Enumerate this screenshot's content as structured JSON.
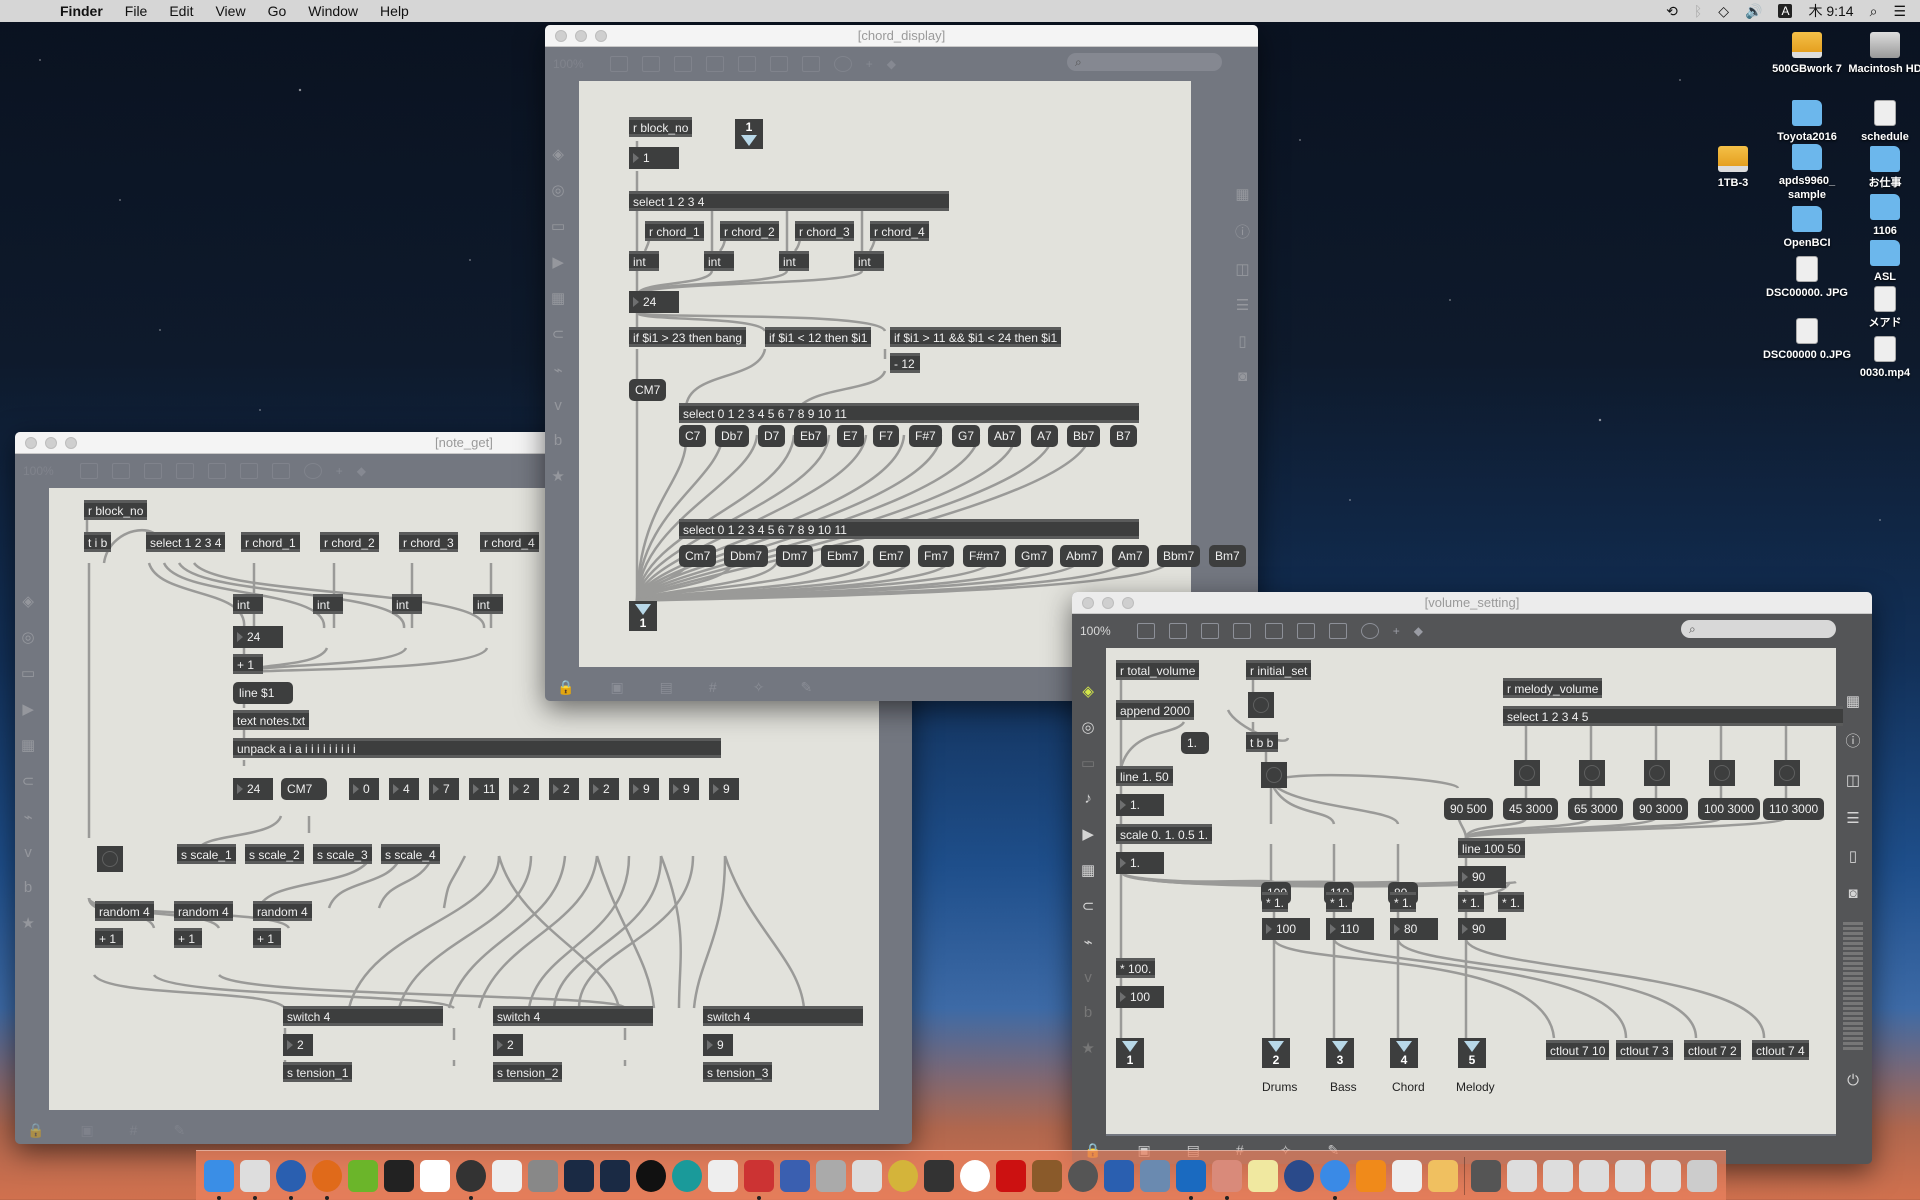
{
  "menubar": {
    "apple": "",
    "items": [
      "Finder",
      "File",
      "Edit",
      "View",
      "Go",
      "Window",
      "Help"
    ],
    "status": {
      "ime": "A",
      "clock": "木 9:14"
    }
  },
  "desktop_icons": [
    {
      "label": "500GBwork\n7",
      "kind": "drive"
    },
    {
      "label": "Macintosh HD",
      "kind": "hd"
    },
    {
      "label": "Toyota2016",
      "kind": "folder"
    },
    {
      "label": "schedule",
      "kind": "file"
    },
    {
      "label": "1TB-3",
      "kind": "drive"
    },
    {
      "label": "apds9960_ sample",
      "kind": "folder"
    },
    {
      "label": "お仕事",
      "kind": "folder"
    },
    {
      "label": "OpenBCI",
      "kind": "folder"
    },
    {
      "label": "1106",
      "kind": "folder"
    },
    {
      "label": "DSC00000. JPG",
      "kind": "file"
    },
    {
      "label": "ASL",
      "kind": "folder"
    },
    {
      "label": "DSC00000 0.JPG",
      "kind": "file"
    },
    {
      "label": "メアド",
      "kind": "file"
    },
    {
      "label": "0030.mp4",
      "kind": "file"
    }
  ],
  "windows": {
    "chord_display": {
      "title": "[chord_display]",
      "zoom": "100%",
      "objects": {
        "r_block_no": "r block_no",
        "num_block": "1",
        "inlet_1": "1",
        "select_1234": "select 1 2 3 4",
        "r_chords": [
          "r chord_1",
          "r chord_2",
          "r chord_3",
          "r chord_4"
        ],
        "ints": [
          "int",
          "int",
          "int",
          "int"
        ],
        "num_24": "24",
        "if1": "if $i1 > 23 then bang",
        "if2": "if $i1 < 12 then $i1",
        "if3": "if $i1 > 11 && $i1 < 24 then $i1",
        "minus12": "- 12",
        "cm7": "CM7",
        "select_a": "select 0 1 2 3 4 5 6 7 8 9 10 11",
        "select_b": "select 0 1 2 3 4 5 6 7 8 9 10 11",
        "dom7": [
          "C7",
          "Db7",
          "D7",
          "Eb7",
          "E7",
          "F7",
          "F#7",
          "G7",
          "Ab7",
          "A7",
          "Bb7",
          "B7"
        ],
        "min7": [
          "Cm7",
          "Dbm7",
          "Dm7",
          "Ebm7",
          "Em7",
          "Fm7",
          "F#m7",
          "Gm7",
          "Abm7",
          "Am7",
          "Bbm7",
          "Bm7"
        ],
        "outlet_1": "1"
      }
    },
    "note_get": {
      "title": "[note_get]",
      "zoom": "100%",
      "objects": {
        "r_block_no": "r block_no",
        "tib": "t i b",
        "select_1234": "select 1 2 3 4",
        "r_chords": [
          "r chord_1",
          "r chord_2",
          "r chord_3",
          "r chord_4"
        ],
        "ints": [
          "int",
          "int",
          "int",
          "int"
        ],
        "num_24": "24",
        "plus1": "+ 1",
        "line": "line $1",
        "text": "text notes.txt",
        "unpack": "unpack a i a i i i i i i i i i",
        "unpack_out": {
          "num": "24",
          "msg": "CM7",
          "nums": [
            "0",
            "4",
            "7",
            "11",
            "2",
            "2",
            "2",
            "9",
            "9",
            "9"
          ]
        },
        "scales": [
          "s scale_1",
          "s scale_2",
          "s scale_3",
          "s scale_4"
        ],
        "randoms": [
          "random 4",
          "random 4",
          "random 4"
        ],
        "plus": [
          "+ 1",
          "+ 1",
          "+ 1"
        ],
        "switches": [
          "switch 4",
          "switch 4",
          "switch 4"
        ],
        "switch_out": [
          "2",
          "2",
          "9"
        ],
        "tensions": [
          "s tension_1",
          "s tension_2",
          "s tension_3"
        ]
      }
    },
    "volume_setting": {
      "title": "[volume_setting]",
      "zoom": "100%",
      "search_placeholder": "",
      "objects": {
        "r_total": "r total_volume",
        "append": "append 2000",
        "msg_1": "1.",
        "line_1": "line 1. 50",
        "num_a": "1.",
        "scale": "scale 0. 1. 0.5 1.",
        "num_b": "1.",
        "mul100": "* 100.",
        "num_100": "100",
        "outlet_1": "1",
        "r_initial": "r initial_set",
        "tbb": "t b b",
        "init_msgs": [
          "100",
          "110",
          "80"
        ],
        "msg_90_500": "90 500",
        "r_melody": "r melody_volume",
        "select_12345": "select 1 2 3 4 5",
        "melody_msgs": [
          "45 3000",
          "65 3000",
          "90 3000",
          "100 3000",
          "110 3000"
        ],
        "line_100": "line 100 50",
        "num_90": "90",
        "muls": [
          "* 1.",
          "* 1.",
          "* 1.",
          "* 1.",
          "* 1."
        ],
        "vol_nums": [
          "100",
          "110",
          "80",
          "90"
        ],
        "outlets": [
          "2",
          "3",
          "4",
          "5"
        ],
        "outlet_labels": [
          "Drums",
          "Bass",
          "Chord",
          "Melody"
        ],
        "ctlouts": [
          "ctlout 7 10",
          "ctlout 7 3",
          "ctlout 7 2",
          "ctlout 7 4"
        ]
      }
    }
  }
}
